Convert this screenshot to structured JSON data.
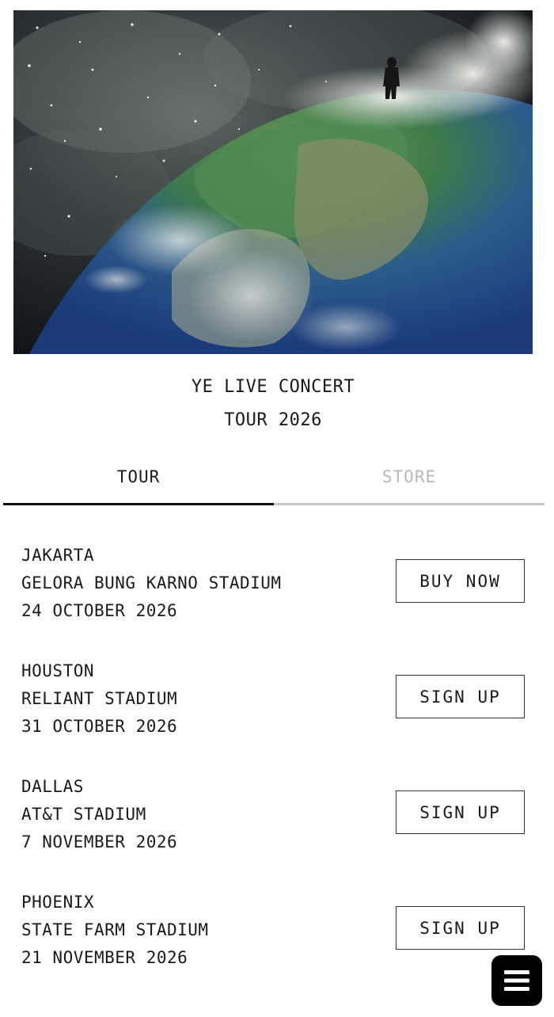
{
  "hero": {
    "image_alt": "figure standing atop clouds on Earth from space"
  },
  "header": {
    "title_line1": "YE LIVE CONCERT",
    "title_line2": "TOUR 2026"
  },
  "tabs": [
    {
      "label": "TOUR",
      "active": true
    },
    {
      "label": "STORE",
      "active": false
    }
  ],
  "events": [
    {
      "city": "JAKARTA",
      "venue": "GELORA BUNG KARNO STADIUM",
      "date": "24 OCTOBER 2026",
      "action": "BUY NOW"
    },
    {
      "city": "HOUSTON",
      "venue": "RELIANT STADIUM",
      "date": "31 OCTOBER 2026",
      "action": "SIGN UP"
    },
    {
      "city": "DALLAS",
      "venue": "AT&T STADIUM",
      "date": "7 NOVEMBER 2026",
      "action": "SIGN UP"
    },
    {
      "city": "PHOENIX",
      "venue": "STATE FARM STADIUM",
      "date": "21 NOVEMBER 2026",
      "action": "SIGN UP"
    }
  ],
  "menu_button": {
    "icon": "menu-icon"
  },
  "colors": {
    "text": "#1a1a1a",
    "inactive_tab": "#b8b8b8",
    "active_underline": "#111111",
    "inactive_underline": "#c8c8c8",
    "fab_bg": "#000000"
  }
}
